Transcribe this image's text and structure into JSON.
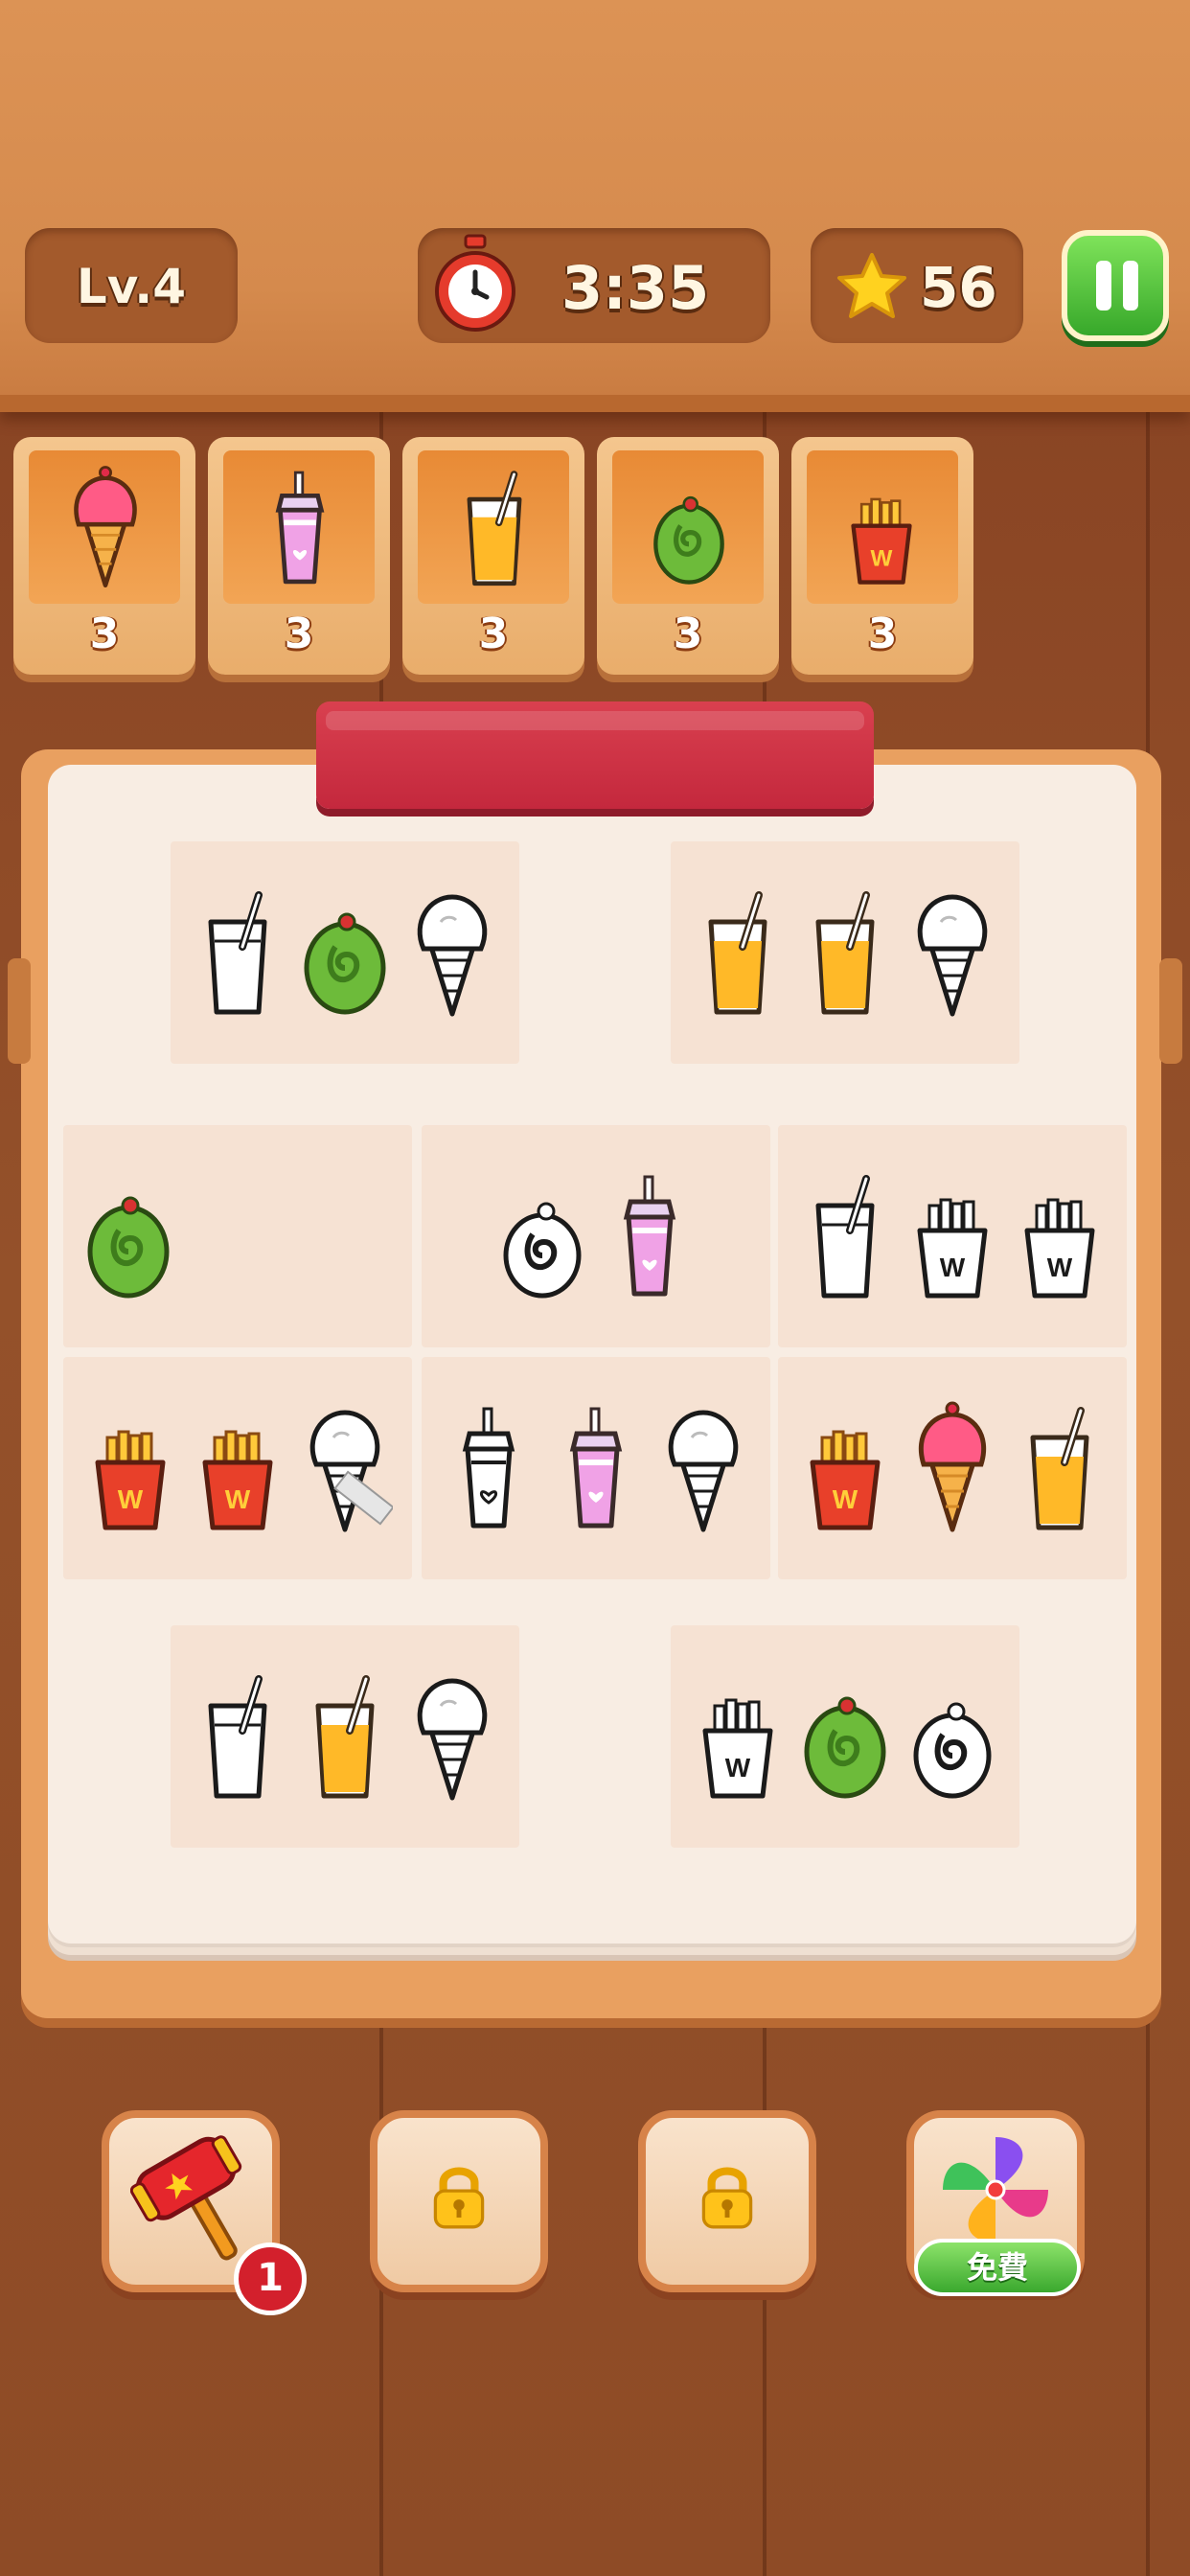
{
  "hud": {
    "level": "Lv.4",
    "timer": "3:35",
    "stars": "56",
    "icons": [
      "stopwatch-icon",
      "star-icon",
      "pause-icon"
    ]
  },
  "goals": [
    {
      "item": "ice-cream",
      "count": "3"
    },
    {
      "item": "bubble-tea",
      "count": "3"
    },
    {
      "item": "orange-juice",
      "count": "3"
    },
    {
      "item": "matcha-roll",
      "count": "3"
    },
    {
      "item": "fries",
      "count": "3"
    }
  ],
  "board": {
    "rows": [
      [
        [
          "milk",
          "matcha-roll",
          "ice-cream-outline"
        ],
        [
          "orange-juice",
          "orange-juice",
          "ice-cream-outline"
        ]
      ],
      [
        [
          "matcha-roll"
        ],
        [
          "matcha-roll-outline",
          "bubble-tea"
        ],
        [
          "milk",
          "fries-outline",
          "fries-outline"
        ]
      ],
      [
        [
          "fries",
          "fries",
          "ice-cream-outline-cut"
        ],
        [
          "bubble-tea-outline",
          "bubble-tea",
          "ice-cream-outline"
        ],
        [
          "fries",
          "ice-cream",
          "orange-juice"
        ]
      ],
      [
        [
          "milk",
          "orange-juice",
          "ice-cream-outline"
        ],
        [
          "fries-outline",
          "matcha-roll",
          "matcha-roll-outline"
        ]
      ]
    ]
  },
  "boosters": {
    "hammer": {
      "icon": "hammer-icon",
      "count": "1"
    },
    "locked_1": {
      "icon": "lock-icon"
    },
    "locked_2": {
      "icon": "lock-icon"
    },
    "shuffle": {
      "icon": "pinwheel-icon",
      "label": "免費"
    }
  },
  "colors": {
    "accent": "#d3202c",
    "wood": "#8a4524",
    "paper": "#f8ede3",
    "green": "#3aa82e"
  }
}
